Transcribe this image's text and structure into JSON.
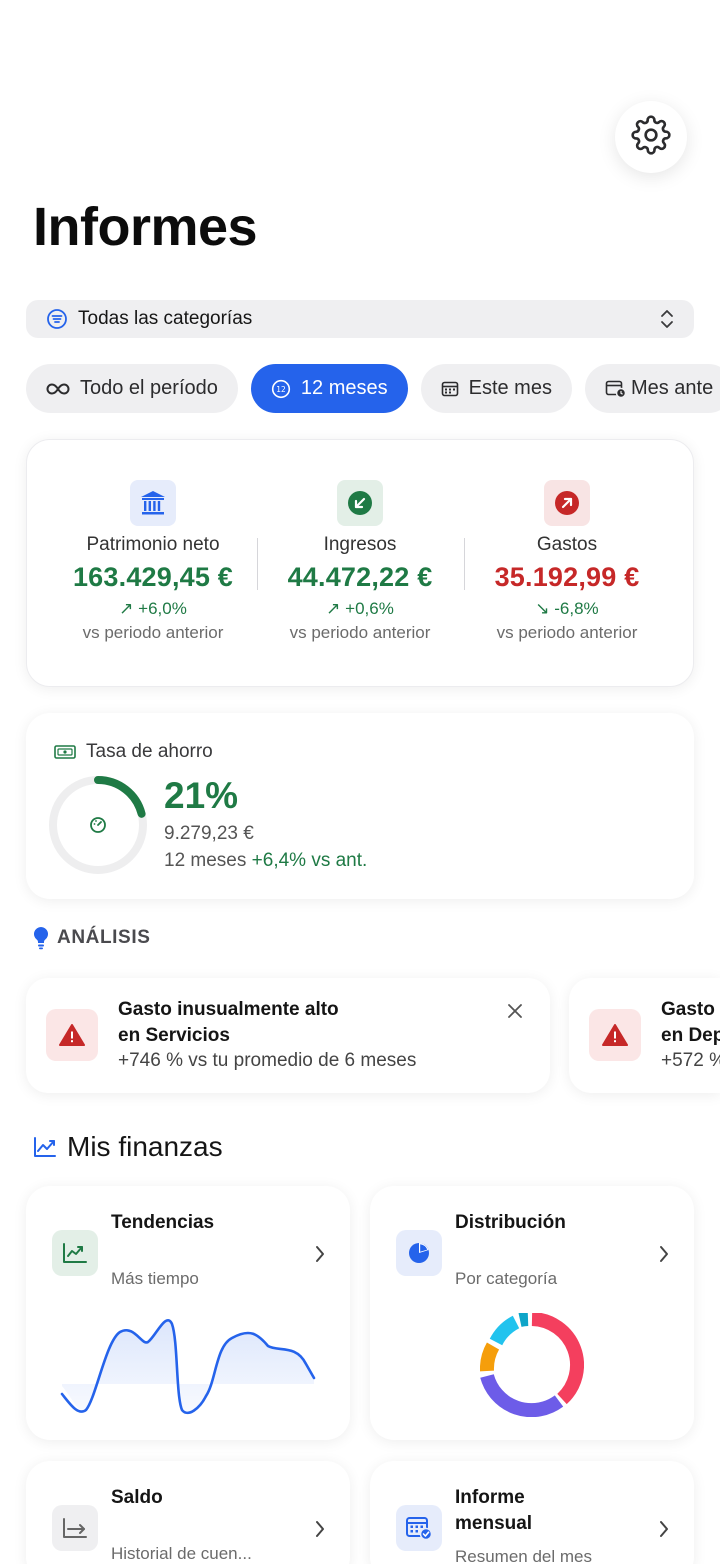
{
  "header": {
    "title": "Informes",
    "settings_icon": "gear-icon"
  },
  "category_filter": {
    "icon": "filter-lines-icon",
    "value": "Todas las categorías",
    "chevron_icon": "chevron-up-down-icon"
  },
  "periods": [
    {
      "label": "Todo el período",
      "icon": "infinity-icon",
      "selected": false
    },
    {
      "label": "12 meses",
      "icon": "calendar-12-icon",
      "selected": true
    },
    {
      "label": "Este mes",
      "icon": "calendar-icon",
      "selected": false
    },
    {
      "label": "Mes ante",
      "icon": "calendar-clock-icon",
      "selected": false
    }
  ],
  "summary": {
    "metrics": [
      {
        "label": "Patrimonio neto",
        "value": "163.429,45 €",
        "change": "↗ +6,0%",
        "sub": "vs periodo anterior",
        "icon": "bank-icon",
        "color": "#1f7a45"
      },
      {
        "label": "Ingresos",
        "value": "44.472,22 €",
        "change": "↗ +0,6%",
        "sub": "vs periodo anterior",
        "icon": "arrow-down-left-icon",
        "color": "#1f7a45"
      },
      {
        "label": "Gastos",
        "value": "35.192,99 €",
        "change": "↘ -6,8%",
        "sub": "vs periodo anterior",
        "icon": "arrow-up-right-icon",
        "color": "#c62828"
      }
    ]
  },
  "savings": {
    "title": "Tasa de ahorro",
    "icon": "banknote-icon",
    "rate": "21%",
    "rate_fraction": 0.21,
    "amount": "9.279,23 €",
    "period": "12 meses",
    "change": "+6,4% vs ant."
  },
  "analysis": {
    "title": "ANÁLISIS",
    "icon": "lightbulb-icon",
    "insights": [
      {
        "title_line1": "Gasto inusualmente alto",
        "title_line2": "en Servicios",
        "detail": "+746 % vs tu promedio de 6 meses",
        "icon": "warning-icon"
      },
      {
        "title_line1": "Gasto",
        "title_line2": "en Dep",
        "detail": "+572 %",
        "icon": "warning-icon"
      }
    ]
  },
  "finances": {
    "title": "Mis finanzas",
    "icon": "trend-chart-icon",
    "tiles": [
      {
        "title": "Tendencias",
        "subtitle": "Más tiempo",
        "icon": "line-chart-icon"
      },
      {
        "title": "Distribución",
        "subtitle": "Por categoría",
        "icon": "pie-chart-icon"
      },
      {
        "title": "Saldo",
        "subtitle": "Historial de cuen...",
        "icon": "balance-axis-icon"
      },
      {
        "title_line1": "Informe",
        "title_line2": "mensual",
        "subtitle": "Resumen del mes",
        "icon": "calendar-check-icon"
      }
    ]
  },
  "colors": {
    "accent": "#2563eb",
    "positive": "#1f7a45",
    "negative": "#c62828",
    "chip_bg": "#efeff1"
  }
}
